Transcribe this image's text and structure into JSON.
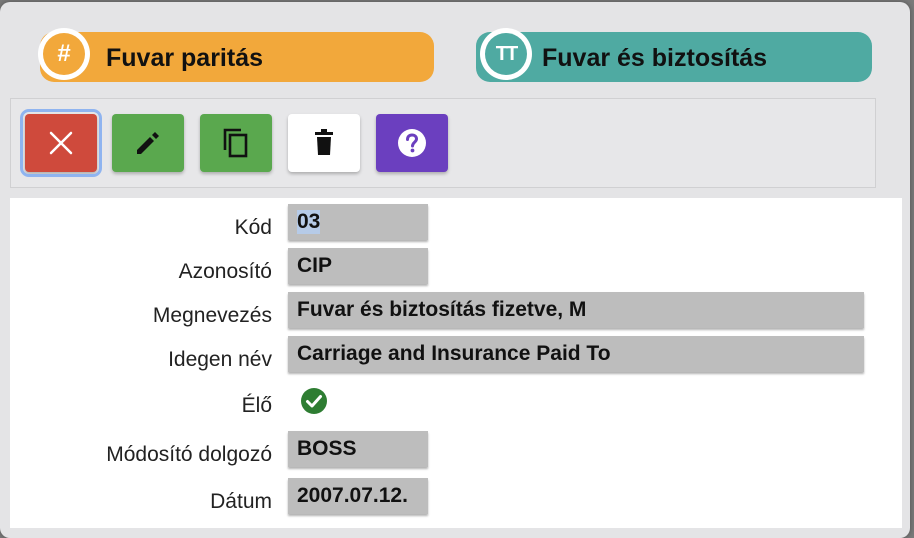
{
  "header": {
    "left_title": "Fuvar paritás",
    "left_icon": "hash-icon",
    "left_icon_glyph": "#",
    "right_title": "Fuvar és biztosítás",
    "right_icon": "text-icon",
    "right_icon_glyph": "TT",
    "colors": {
      "orange": "#f2a83b",
      "teal": "#4faaa2"
    }
  },
  "toolbar": {
    "buttons": [
      {
        "name": "close",
        "icon": "close-icon",
        "color": "#cf4a3c"
      },
      {
        "name": "edit",
        "icon": "pencil-icon",
        "color": "#5aa84e"
      },
      {
        "name": "copy",
        "icon": "copy-icon",
        "color": "#5aa84e"
      },
      {
        "name": "delete",
        "icon": "trash-icon",
        "color": "#ffffff"
      },
      {
        "name": "help",
        "icon": "help-icon",
        "color": "#6b3fbf"
      }
    ]
  },
  "form": {
    "kod": {
      "label": "Kód",
      "value": "03"
    },
    "azonosito": {
      "label": "Azonosító",
      "value": "CIP"
    },
    "megnevezes": {
      "label": "Megnevezés",
      "value": "Fuvar és biztosítás fizetve, M"
    },
    "idegen_nev": {
      "label": "Idegen név",
      "value": "Carriage and Insurance Paid To"
    },
    "elo": {
      "label": "Élő",
      "checked": true,
      "icon": "check-circle-icon"
    },
    "modosito": {
      "label": "Módosító dolgozó",
      "value": "BOSS"
    },
    "datum": {
      "label": "Dátum",
      "value": "2007.07.12."
    }
  }
}
